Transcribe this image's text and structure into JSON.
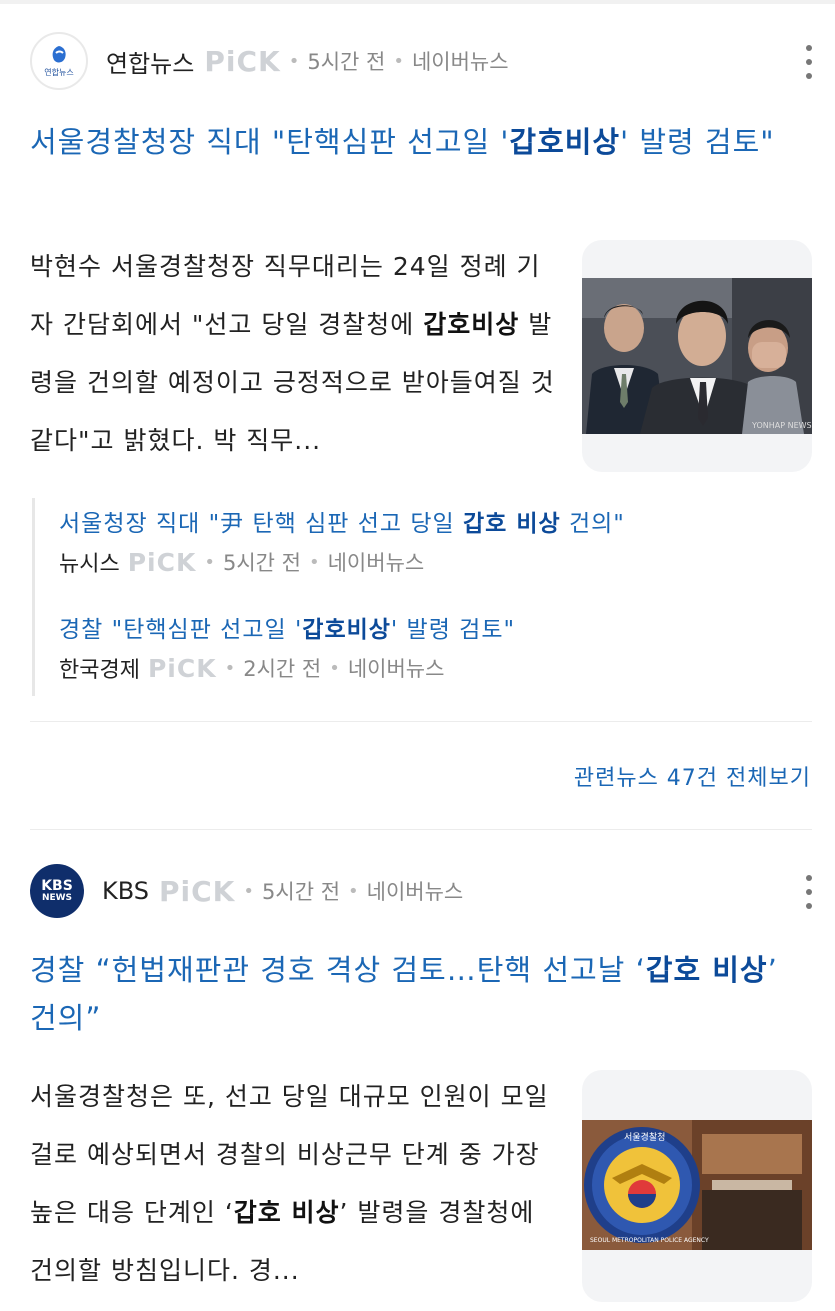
{
  "articles": [
    {
      "source": "연합뉴스",
      "logo_text": "연합뉴스",
      "pick": "PiCK",
      "time": "5시간 전",
      "platform": "네이버뉴스",
      "headline_pre": "서울경찰청장 직대 \"탄핵심판 선고일 '",
      "headline_strong": "갑호비상",
      "headline_post": "' 발령 검토\"",
      "body_pre": "박현수 서울경찰청장 직무대리는 24일 정례 기자 간담회에서 \"선고 당일 경찰청에 ",
      "body_strong": "갑호비상",
      "body_post": " 발령을 건의할 예정이고 긍정적으로 받아들여질 것 같다\"고 밝혔다. 박 직무...",
      "thumb_watermark": "YONHAP NEWS",
      "related": [
        {
          "title_pre": "서울청장 직대 \"尹 탄핵 심판 선고 당일 ",
          "title_strong": "갑호 비상",
          "title_post": " 건의\"",
          "source": "뉴시스",
          "pick": "PiCK",
          "time": "5시간 전",
          "platform": "네이버뉴스"
        },
        {
          "title_pre": "경찰 \"탄핵심판 선고일 '",
          "title_strong": "갑호비상",
          "title_post": "' 발령 검토\"",
          "source": "한국경제",
          "pick": "PiCK",
          "time": "2시간 전",
          "platform": "네이버뉴스"
        }
      ],
      "more_link": "관련뉴스 47건 전체보기"
    },
    {
      "source": "KBS",
      "logo_text_1": "KBS",
      "logo_text_2": "NEWS",
      "pick": "PiCK",
      "time": "5시간 전",
      "platform": "네이버뉴스",
      "headline_pre": "경찰 “헌법재판관 경호 격상 검토…탄핵 선고날 ‘",
      "headline_strong": "갑호 비상",
      "headline_post": "’ 건의”",
      "body_pre": "서울경찰청은 또, 선고 당일 대규모 인원이 모일 걸로 예상되면서 경찰의 비상근무 단계 중 가장 높은 대응 단계인 ‘",
      "body_strong": "갑호 비상",
      "body_post": "’ 발령을 경찰청에 건의할 방침입니다. 경...",
      "thumb_emblem_text": "서울경찰청",
      "thumb_ring_text": "SEOUL METROPOLITAN POLICE AGENCY"
    }
  ],
  "colors": {
    "link": "#1b67b5",
    "pick": "#cfd2d6",
    "meta": "#888888",
    "kbs": "#0f2e6b"
  }
}
